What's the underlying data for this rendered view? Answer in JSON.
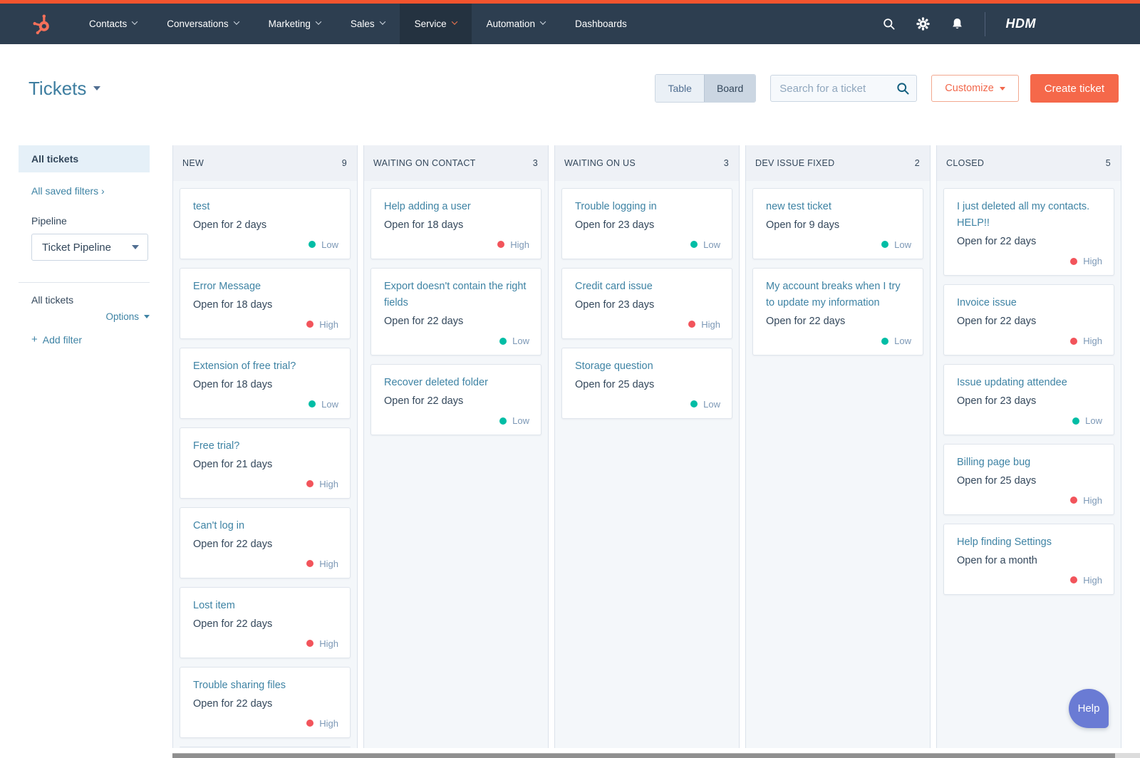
{
  "colors": {
    "primary_orange": "#f5684a",
    "top_strip_orange": "#f4542e",
    "nav_bg": "#2d3e50",
    "link_teal": "#3e83a4",
    "low": "#00bda5",
    "high": "#f2545b",
    "help_purple": "#6a7bd4"
  },
  "nav": {
    "items": [
      {
        "label": "Contacts",
        "caret": true,
        "active": false
      },
      {
        "label": "Conversations",
        "caret": true,
        "active": false
      },
      {
        "label": "Marketing",
        "caret": true,
        "active": false
      },
      {
        "label": "Sales",
        "caret": true,
        "active": false
      },
      {
        "label": "Service",
        "caret": true,
        "active": true
      },
      {
        "label": "Automation",
        "caret": true,
        "active": false
      },
      {
        "label": "Dashboards",
        "caret": false,
        "active": false
      }
    ],
    "brand": "HDM"
  },
  "header": {
    "title": "Tickets",
    "table_label": "Table",
    "board_label": "Board",
    "active_view": "Board",
    "search_placeholder": "Search for a ticket",
    "customize_label": "Customize",
    "create_ticket_label": "Create ticket"
  },
  "sidebar": {
    "selected_view": "All tickets",
    "saved_filters_label": "All saved filters",
    "pipeline_label": "Pipeline",
    "pipeline_value": "Ticket Pipeline",
    "list_title": "All tickets",
    "options_label": "Options",
    "add_filter_label": "Add filter"
  },
  "board": {
    "columns": [
      {
        "name": "NEW",
        "count": "9",
        "partial_bottom_card": true,
        "cards": [
          {
            "title": "test",
            "age": "Open for 2 days",
            "priority": "Low"
          },
          {
            "title": "Error Message",
            "age": "Open for 18 days",
            "priority": "High"
          },
          {
            "title": "Extension of free trial?",
            "age": "Open for 18 days",
            "priority": "Low"
          },
          {
            "title": "Free trial?",
            "age": "Open for 21 days",
            "priority": "High"
          },
          {
            "title": "Can't log in",
            "age": "Open for 22 days",
            "priority": "High"
          },
          {
            "title": "Lost item",
            "age": "Open for 22 days",
            "priority": "High"
          },
          {
            "title": "Trouble sharing files",
            "age": "Open for 22 days",
            "priority": "High"
          }
        ]
      },
      {
        "name": "WAITING ON CONTACT",
        "count": "3",
        "partial_bottom_card": false,
        "cards": [
          {
            "title": "Help adding a user",
            "age": "Open for 18 days",
            "priority": "High"
          },
          {
            "title": "Export doesn't contain the right fields",
            "age": "Open for 22 days",
            "priority": "Low"
          },
          {
            "title": "Recover deleted folder",
            "age": "Open for 22 days",
            "priority": "Low"
          }
        ]
      },
      {
        "name": "WAITING ON US",
        "count": "3",
        "partial_bottom_card": false,
        "cards": [
          {
            "title": "Trouble logging in",
            "age": "Open for 23 days",
            "priority": "Low"
          },
          {
            "title": "Credit card issue",
            "age": "Open for 23 days",
            "priority": "High"
          },
          {
            "title": "Storage question",
            "age": "Open for 25 days",
            "priority": "Low"
          }
        ]
      },
      {
        "name": "DEV ISSUE FIXED",
        "count": "2",
        "partial_bottom_card": false,
        "cards": [
          {
            "title": "new test ticket",
            "age": "Open for 9 days",
            "priority": "Low"
          },
          {
            "title": "My account breaks when I try to update my information",
            "age": "Open for 22 days",
            "priority": "Low"
          }
        ]
      },
      {
        "name": "CLOSED",
        "count": "5",
        "partial_bottom_card": false,
        "cards": [
          {
            "title": "I just deleted all my contacts. HELP!!",
            "age": "Open for 22 days",
            "priority": "High"
          },
          {
            "title": "Invoice issue",
            "age": "Open for 22 days",
            "priority": "High"
          },
          {
            "title": "Issue updating attendee",
            "age": "Open for 23 days",
            "priority": "Low"
          },
          {
            "title": "Billing page bug",
            "age": "Open for 25 days",
            "priority": "High"
          },
          {
            "title": "Help finding Settings",
            "age": "Open for a month",
            "priority": "High"
          }
        ]
      }
    ]
  },
  "help": {
    "label": "Help"
  }
}
